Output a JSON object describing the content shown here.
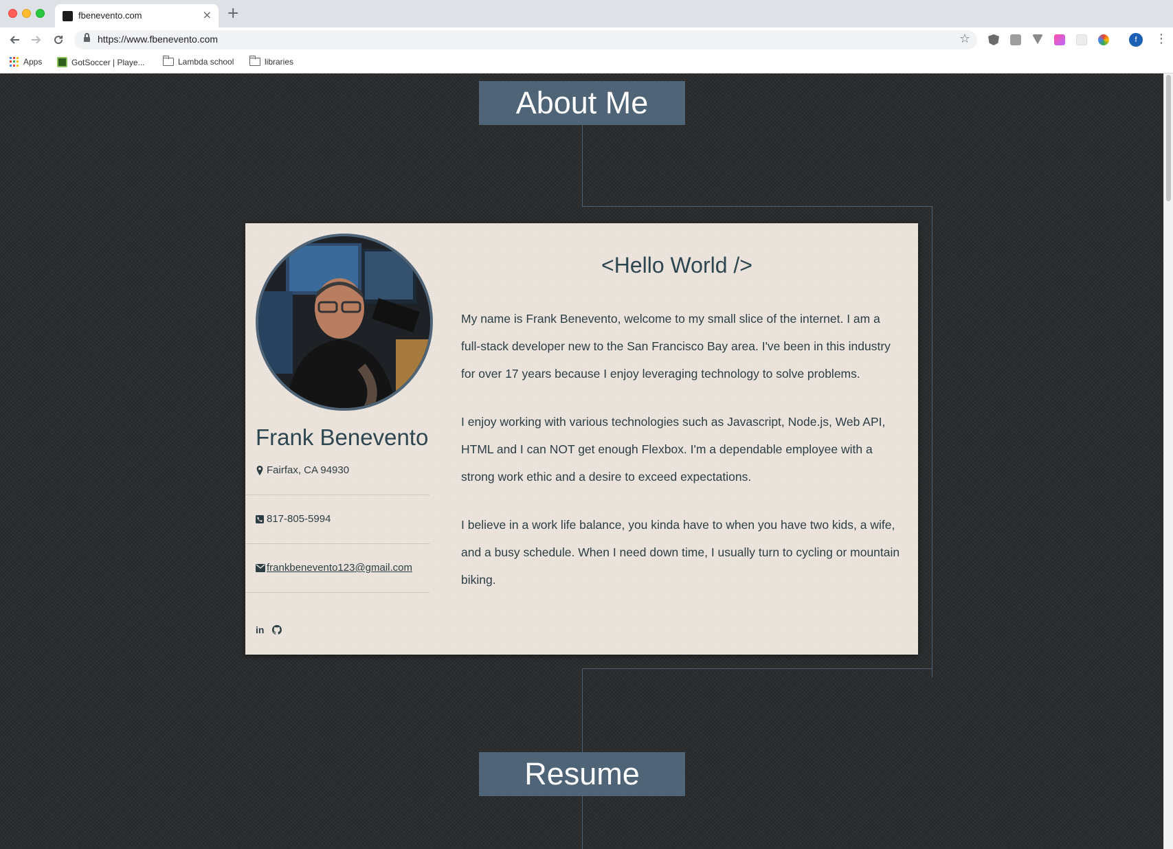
{
  "browser": {
    "tab_title": "fbenevento.com",
    "tab_close": "×",
    "new_tab": "+",
    "url": "https://www.fbenevento.com",
    "profile_initial": "f",
    "bookmarks": [
      {
        "label": "Apps",
        "icon": "apps-grid-icon"
      },
      {
        "label": "GotSoccer | Playe...",
        "icon": "gotsoccer-icon"
      },
      {
        "label": "Lambda school",
        "icon": "folder-icon"
      },
      {
        "label": "libraries",
        "icon": "folder-icon"
      }
    ],
    "extensions": [
      "angular-icon",
      "ublock-icon",
      "vue-icon",
      "gradient-icon",
      "grid-icon",
      "color-picker-icon"
    ]
  },
  "page": {
    "about_header": "About Me",
    "resume_header": "Resume",
    "profile": {
      "name": "Frank Benevento",
      "location": "Fairfax, CA 94930",
      "phone": "817-805-5994",
      "email": "frankbenevento123@gmail.com",
      "socials": [
        "in",
        "github"
      ]
    },
    "intro": {
      "heading": "<Hello World />",
      "p1": "My name is Frank Benevento, welcome to my small slice of the internet. I am a full-stack developer new to the San Francisco Bay area. I've been in this industry for over 17 years because I enjoy leveraging technology to solve problems.",
      "p2": "I enjoy working with various technologies such as Javascript, Node.js, Web API, HTML and I can NOT get enough Flexbox. I'm a dependable employee with a strong work ethic and a desire to exceed expectations.",
      "p3": "I believe in a work life balance, you kinda have to when you have two kids, a wife, and a busy schedule. When I need down time, I usually turn to cycling or mountain biking."
    }
  },
  "colors": {
    "page_bg": "#2b2d2f",
    "header_bg": "#4f6577",
    "card_bg": "#ece4dd",
    "text": "#2c3e44"
  }
}
